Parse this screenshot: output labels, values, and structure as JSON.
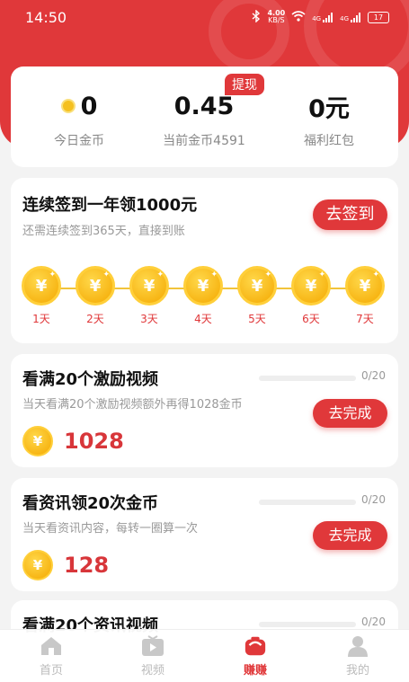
{
  "status_bar": {
    "time": "14:50",
    "speed_value": "4.00",
    "speed_unit": "KB/S",
    "network_1": "4G",
    "network_2": "4G",
    "battery": "17"
  },
  "stats": {
    "today_coins_value": "0",
    "today_coins_label": "今日金币",
    "current_value": "0.45",
    "current_label": "当前金币4591",
    "withdraw_label": "提现",
    "bonus_value": "0元",
    "bonus_label": "福利红包"
  },
  "signin": {
    "title": "连续签到一年领1000元",
    "subtitle": "还需连续签到365天，直接到账",
    "button": "去签到",
    "coin_symbol": "¥",
    "days": [
      "1天",
      "2天",
      "3天",
      "4天",
      "5天",
      "6天",
      "7天"
    ]
  },
  "tasks": [
    {
      "title": "看满20个激励视频",
      "desc": "当天看满20个激励视频额外再得1028金币",
      "progress": "0/20",
      "progress_fraction": 0,
      "button": "去完成",
      "reward": "1028"
    },
    {
      "title": "看资讯领20次金币",
      "desc": "当天看资讯内容，每转一圈算一次",
      "progress": "0/20",
      "progress_fraction": 0,
      "button": "去完成",
      "reward": "128"
    },
    {
      "title": "看满20个资讯视频",
      "progress": "0/20",
      "progress_fraction": 0
    }
  ],
  "nav": [
    {
      "label": "首页",
      "icon": "home-icon"
    },
    {
      "label": "视频",
      "icon": "video-icon"
    },
    {
      "label": "赚赚",
      "icon": "earn-icon",
      "active": true
    },
    {
      "label": "我的",
      "icon": "profile-icon"
    }
  ],
  "colors": {
    "accent": "#e0383a",
    "coin": "#f4b400",
    "background": "#f3f3f3"
  }
}
